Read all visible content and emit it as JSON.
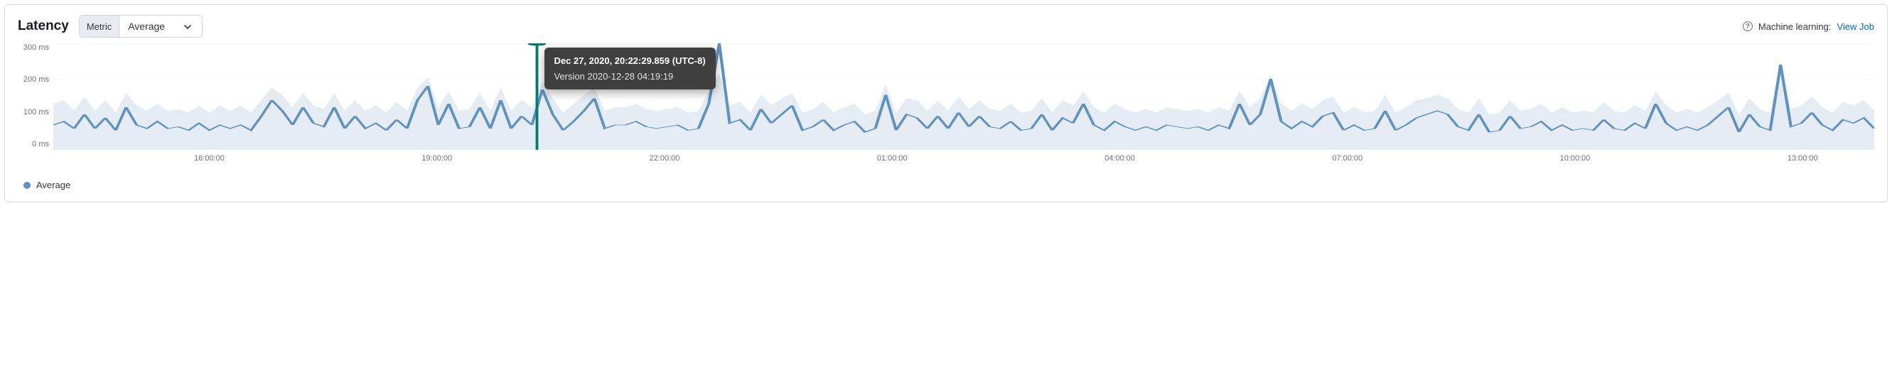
{
  "header": {
    "title": "Latency",
    "metric_label": "Metric",
    "metric_value": "Average",
    "ml_prefix": "Machine learning: ",
    "ml_link": "View Job"
  },
  "legend": {
    "series_label": "Average"
  },
  "tooltip": {
    "timestamp": "Dec 27, 2020, 20:22:29.859 (UTC-8)",
    "version": "Version 2020-12-28 04:19:19"
  },
  "chart_data": {
    "type": "line",
    "title": "Latency",
    "ylabel": "ms",
    "ylim": [
      0,
      300
    ],
    "y_ticks": [
      "300 ms",
      "200 ms",
      "100 ms",
      "0 ms"
    ],
    "x_range_hours": [
      "14:00:00",
      "14:00:00_next_day"
    ],
    "x_ticks": [
      "16:00:00",
      "19:00:00",
      "22:00:00",
      "01:00:00",
      "04:00:00",
      "07:00:00",
      "10:00:00",
      "13:00:00"
    ],
    "marker": {
      "time": "20:22:29",
      "label": "Dec 27, 2020, 20:22:29.859 (UTC-8)"
    },
    "series": [
      {
        "name": "Average",
        "color": "#6092c0",
        "values": [
          70,
          80,
          60,
          100,
          60,
          90,
          55,
          120,
          70,
          60,
          80,
          60,
          65,
          55,
          75,
          55,
          70,
          60,
          70,
          55,
          95,
          140,
          110,
          70,
          120,
          75,
          65,
          120,
          60,
          95,
          60,
          75,
          55,
          85,
          60,
          140,
          180,
          70,
          130,
          60,
          65,
          120,
          60,
          140,
          60,
          95,
          70,
          170,
          100,
          55,
          80,
          110,
          145,
          60,
          70,
          70,
          80,
          65,
          60,
          65,
          70,
          55,
          60,
          130,
          300,
          75,
          85,
          55,
          115,
          75,
          100,
          125,
          55,
          65,
          85,
          55,
          70,
          80,
          50,
          60,
          155,
          55,
          100,
          90,
          60,
          95,
          60,
          105,
          65,
          95,
          65,
          60,
          80,
          55,
          60,
          100,
          55,
          90,
          75,
          130,
          70,
          55,
          80,
          65,
          55,
          65,
          55,
          70,
          65,
          60,
          65,
          55,
          70,
          60,
          130,
          70,
          100,
          200,
          80,
          60,
          80,
          65,
          95,
          105,
          55,
          70,
          55,
          60,
          110,
          55,
          70,
          90,
          100,
          110,
          100,
          65,
          55,
          100,
          50,
          55,
          95,
          60,
          65,
          80,
          55,
          70,
          55,
          60,
          55,
          85,
          60,
          55,
          75,
          60,
          130,
          75,
          55,
          65,
          55,
          70,
          95,
          120,
          50,
          100,
          65,
          55,
          240,
          65,
          75,
          105,
          70,
          55,
          85,
          75,
          90,
          60
        ]
      }
    ],
    "band_upper": [
      130,
      140,
      110,
      150,
      110,
      140,
      105,
      160,
      125,
      110,
      130,
      110,
      115,
      105,
      125,
      105,
      125,
      110,
      125,
      105,
      140,
      175,
      155,
      120,
      160,
      125,
      115,
      160,
      110,
      140,
      110,
      125,
      105,
      135,
      110,
      175,
      205,
      120,
      165,
      110,
      115,
      160,
      110,
      175,
      110,
      140,
      120,
      195,
      145,
      105,
      130,
      155,
      175,
      110,
      120,
      120,
      130,
      115,
      110,
      115,
      120,
      105,
      110,
      165,
      215,
      125,
      135,
      105,
      155,
      125,
      145,
      160,
      105,
      115,
      135,
      105,
      120,
      130,
      100,
      110,
      185,
      105,
      145,
      140,
      110,
      140,
      110,
      150,
      115,
      140,
      115,
      110,
      130,
      105,
      110,
      145,
      105,
      140,
      125,
      165,
      120,
      105,
      130,
      115,
      105,
      115,
      105,
      120,
      115,
      110,
      115,
      105,
      120,
      110,
      165,
      120,
      145,
      210,
      130,
      110,
      130,
      115,
      140,
      150,
      105,
      120,
      105,
      110,
      155,
      105,
      120,
      140,
      145,
      155,
      145,
      115,
      105,
      145,
      100,
      105,
      140,
      110,
      115,
      130,
      105,
      120,
      105,
      110,
      105,
      135,
      110,
      105,
      125,
      110,
      165,
      125,
      105,
      115,
      105,
      120,
      140,
      160,
      100,
      145,
      115,
      105,
      230,
      115,
      125,
      150,
      120,
      105,
      135,
      125,
      140,
      110
    ]
  }
}
